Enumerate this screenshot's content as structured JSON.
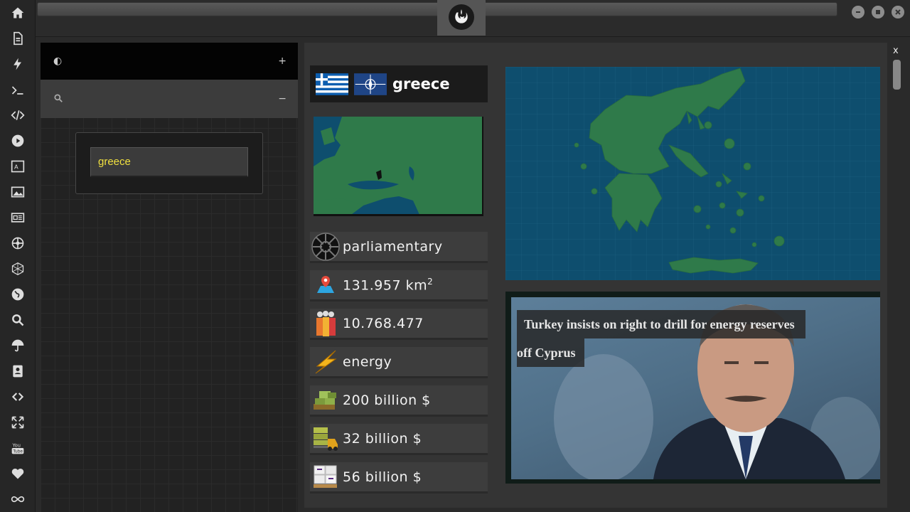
{
  "rail": {
    "icons": [
      "home-icon",
      "document-icon",
      "lightning-icon",
      "terminal-icon",
      "code-icon",
      "play-icon",
      "translate-icon",
      "image-icon",
      "newspaper-icon",
      "empire-icon",
      "hexagon-icon",
      "globe-icon",
      "search-icon",
      "umbrella-icon",
      "contact-icon",
      "link-icon",
      "expand-icon",
      "youtube-icon",
      "heart-icon",
      "infinity-icon"
    ]
  },
  "topbar": {
    "logo": "rebel-alliance-icon"
  },
  "left_panel": {
    "row1_left": "◐",
    "row1_right": "+",
    "row2_right": "−",
    "search_value": "greece"
  },
  "main": {
    "close_label": "x",
    "country": "greece",
    "government": "parliamentary",
    "area": "131.957 km",
    "area_sup": "2",
    "population": "10.768.477",
    "resource": "energy",
    "gdp": "200 billion $",
    "exports": "32 billion $",
    "imports": "56 billion $",
    "news_line1": "Turkey insists on right to drill for energy reserves",
    "news_line2": "off Cyprus"
  },
  "colors": {
    "sea": "#0e4e6e",
    "land": "#2f7a4a",
    "search_text": "#f0e040"
  }
}
